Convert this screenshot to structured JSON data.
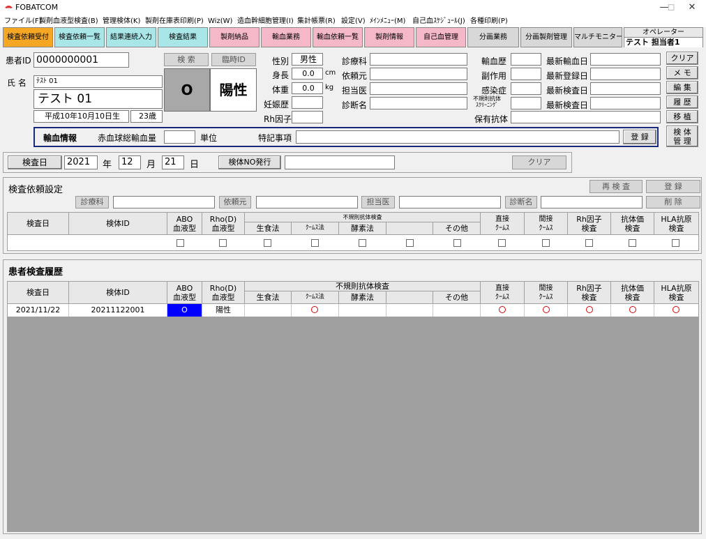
{
  "window": {
    "title": "FOBATCOM"
  },
  "menu": [
    "ファイル(F)",
    "製剤血液型検査(B)",
    "管理検体(K)",
    "製剤在庫表印刷(P)",
    "Wiz(W)",
    "造血幹細胞管理(I)",
    "集計帳票(R)",
    "設定(V)",
    "ﾒｲﾝﾒﾆｭｰ(M)",
    "自己血ｽｹｼﾞｭｰﾙ(J)",
    "各種印刷(P)"
  ],
  "toolbar": [
    "検査依頼受付",
    "検査依頼一覧",
    "結果連続入力",
    "検査結果",
    "製剤納品",
    "輸血業務",
    "輸血依頼一覧",
    "製剤情報",
    "自己血管理",
    "分画業務",
    "分画製剤管理",
    "マルチモニター"
  ],
  "operator": {
    "label": "オペレーター",
    "name": "テスト 担当者1"
  },
  "patient": {
    "id_label": "患者ID",
    "id": "0000000001",
    "search": "検 索",
    "temp_id": "臨時ID",
    "name_label": "氏 名",
    "kana": "ﾃｽﾄ 01",
    "name": "テスト 01",
    "birth": "平成10年10月10日生",
    "age": "23歳",
    "abo": "O",
    "rh": "陽性",
    "sex_label": "性別",
    "sex": "男性",
    "height_label": "身長",
    "height": "0.0",
    "height_unit": "cm",
    "weight_label": "体重",
    "weight": "0.0",
    "weight_unit": "kg",
    "preg_label": "妊娠歴",
    "rhf_label": "Rh因子",
    "dept_label": "診療科",
    "req_label": "依頼元",
    "doc_label": "担当医",
    "diag_label": "診断名",
    "trans_label": "輸血歴",
    "side_label": "副作用",
    "infect_label": "感染症",
    "irr_label": "不規則抗体\nｽｸﾘｰﾆﾝｸﾞ",
    "hold_label": "保有抗体",
    "last_trans": "最新輸血日",
    "last_reg": "最新登録日",
    "last_exam1": "最新検査日",
    "last_exam2": "最新検査日"
  },
  "side_buttons": [
    "クリア",
    "メ モ",
    "編 集",
    "履 歴",
    "移 植",
    "検 体\n管 理"
  ],
  "transfusion": {
    "title": "輸血情報",
    "rbc_label": "赤血球総輸血量",
    "unit": "単位",
    "note_label": "特記事項",
    "register": "登 録"
  },
  "exam_date": {
    "btn": "検査日",
    "year": "2021",
    "y": "年",
    "month": "12",
    "m": "月",
    "day": "21",
    "d": "日",
    "issue": "検体NO発行",
    "clear": "クリア"
  },
  "request": {
    "title": "検査依頼設定",
    "retest": "再 検 査",
    "register": "登 録",
    "delete": "削 除",
    "dept": "診療科",
    "req": "依頼元",
    "doc": "担当医",
    "diag": "診断名"
  },
  "columns": {
    "date": "検査日",
    "sample": "検体ID",
    "abo": "ABO\n血液型",
    "rho": "Rho(D)\n血液型",
    "irr": "不規則抗体検査",
    "saline": "生食法",
    "coombs": "ｸｰﾑｽ法",
    "enzyme": "酵素法",
    "other": "その他",
    "direct": "直接\nｸｰﾑｽ",
    "indirect": "間接\nｸｰﾑｽ",
    "rhf": "Rh因子\n検査",
    "titer": "抗体価\n検査",
    "hla": "HLA抗原\n検査"
  },
  "history": {
    "title": "患者検査履歴",
    "rows": [
      {
        "date": "2021/11/22",
        "sample": "20211122001",
        "abo": "O",
        "rho": "陽性"
      }
    ]
  },
  "colors": {
    "orange": "#f5a623",
    "cyan": "#a8e6e8",
    "pink": "#f5b8c8",
    "gray": "#d8d8d8",
    "blue": "#0000ff"
  }
}
